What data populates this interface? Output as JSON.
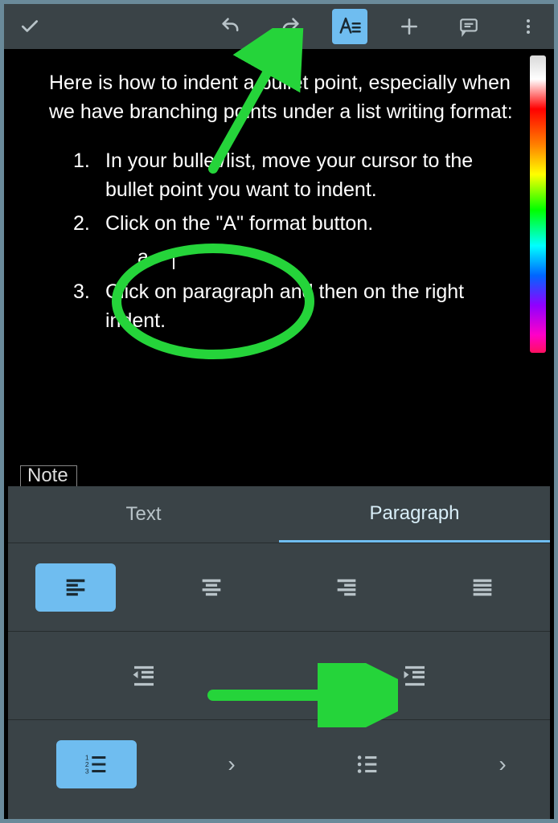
{
  "toolbar": {
    "done": "✓",
    "undo": "undo",
    "redo": "redo",
    "format": "A≡",
    "add": "+",
    "comment": "comment",
    "more": "⋮"
  },
  "doc": {
    "intro": "Here is how to indent a bullet point, especially when we have branching points under a list writing format:",
    "steps": [
      "In your bullet/list, move your cursor to the bullet point you want to indent.",
      "Click on the \"A\" format button.",
      "Click on paragraph and then on the right indent."
    ],
    "sub_a": ""
  },
  "note_label": "Note",
  "panel": {
    "tabs": {
      "text": "Text",
      "paragraph": "Paragraph"
    },
    "active_tab": "paragraph",
    "align": [
      "left",
      "center",
      "right",
      "justify"
    ],
    "indent": [
      "decrease",
      "increase"
    ],
    "lists": [
      "numbered",
      "bulleted"
    ]
  },
  "annotations": {
    "arrow_top": "points to format (A) button",
    "circle": "circles step 2 and sub-item a",
    "arrow_bottom": "points to increase-indent button"
  }
}
